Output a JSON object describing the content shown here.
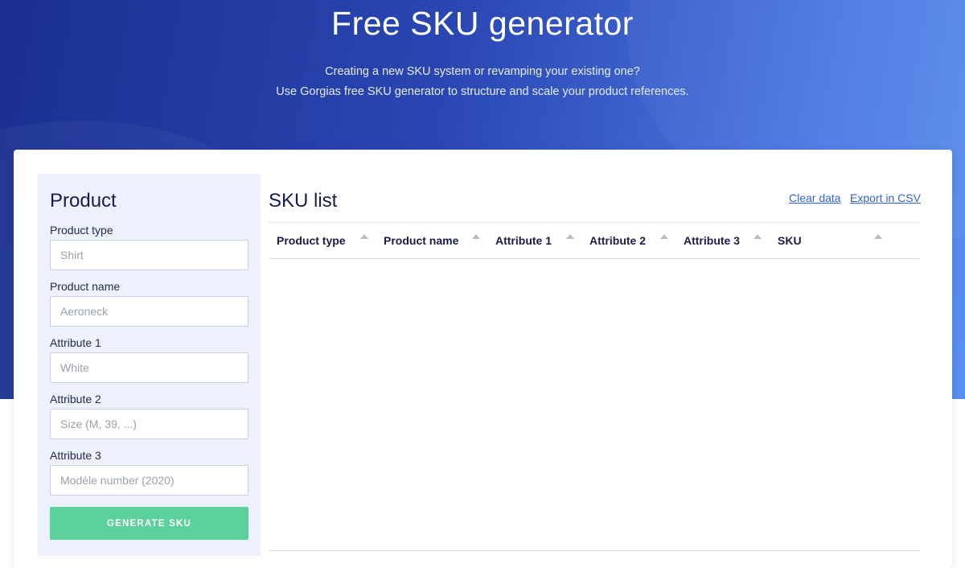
{
  "hero": {
    "title": "Free SKU generator",
    "subtitle_line1": "Creating a new SKU system or revamping your existing one?",
    "subtitle_line2": "Use Gorgias free SKU generator to structure and scale your product references."
  },
  "form": {
    "title": "Product",
    "fields": [
      {
        "label": "Product type",
        "placeholder": "Shirt",
        "value": ""
      },
      {
        "label": "Product name",
        "placeholder": "Aeroneck",
        "value": ""
      },
      {
        "label": "Attribute 1",
        "placeholder": "White",
        "value": ""
      },
      {
        "label": "Attribute 2",
        "placeholder": "Size (M, 39, ...)",
        "value": ""
      },
      {
        "label": "Attribute 3",
        "placeholder": "Modèle number (2020)",
        "value": ""
      }
    ],
    "button_label": "GENERATE SKU"
  },
  "sku_list": {
    "title": "SKU list",
    "clear_label": "Clear data",
    "export_label": "Export in CSV",
    "columns": [
      "Product type",
      "Product name",
      "Attribute 1",
      "Attribute 2",
      "Attribute 3",
      "SKU"
    ],
    "rows": []
  },
  "colors": {
    "hero_gradient_start": "#1a2f8f",
    "hero_gradient_end": "#5a8ef0",
    "button": "#5dd19b",
    "link": "#2f63d8",
    "form_panel": "#edf1fd"
  }
}
